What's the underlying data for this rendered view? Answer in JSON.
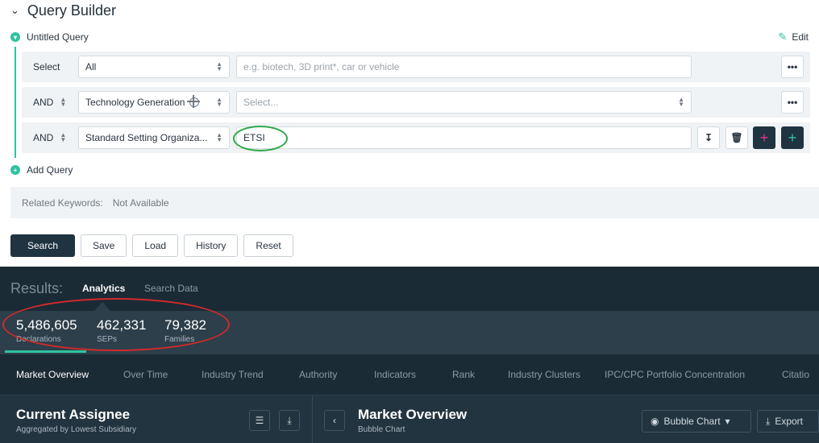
{
  "query_builder": {
    "title": "Query Builder",
    "query_name": "Untitled Query",
    "edit_label": "Edit",
    "rows": [
      {
        "operator": "Select",
        "field": "All",
        "value": "",
        "placeholder": "e.g. biotech, 3D print*, car or vehicle"
      },
      {
        "operator": "AND",
        "field": "Technology Generation",
        "value": "",
        "placeholder": "Select..."
      },
      {
        "operator": "AND",
        "field": "Standard Setting Organiza...",
        "value": "ETSI",
        "placeholder": ""
      }
    ],
    "more_label": "•••",
    "add_query_label": "Add Query",
    "related_keywords_label": "Related Keywords:",
    "related_keywords_value": "Not Available",
    "actions": {
      "search": "Search",
      "save": "Save",
      "load": "Load",
      "history": "History",
      "reset": "Reset"
    }
  },
  "results": {
    "label": "Results:",
    "tabs": {
      "analytics": "Analytics",
      "search_data": "Search Data"
    },
    "stats": [
      {
        "value": "5,486,605",
        "label": "Declarations"
      },
      {
        "value": "462,331",
        "label": "SEPs"
      },
      {
        "value": "79,382",
        "label": "Families"
      }
    ],
    "subtabs": [
      "Market Overview",
      "Over Time",
      "Industry Trend",
      "Authority",
      "Indicators",
      "Rank",
      "Industry Clusters",
      "IPC/CPC Portfolio Concentration",
      "Citatio"
    ],
    "left_panel": {
      "title": "Current Assignee",
      "subtitle": "Aggregated by Lowest Subsidiary"
    },
    "right_panel": {
      "title": "Market Overview",
      "subtitle": "Bubble Chart",
      "chart_type": "Bubble Chart",
      "export_label": "Export"
    }
  },
  "colors": {
    "accent": "#2fc29f",
    "dark": "#1b2b36",
    "annotation_green": "#2fa84a",
    "annotation_red": "#d02a2a"
  }
}
